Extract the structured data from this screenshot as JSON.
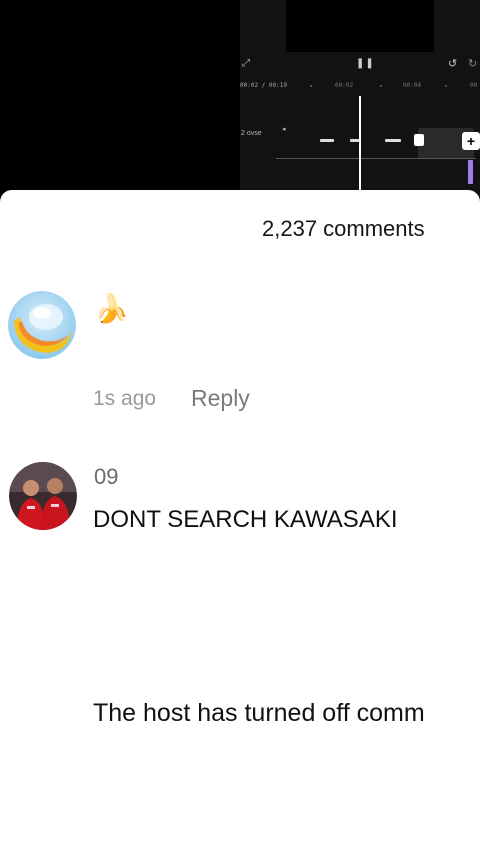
{
  "editor": {
    "timecode": "00:02 / 00:19",
    "ruler_marks": [
      "00:02",
      "00:04",
      "00"
    ],
    "track_label": "2 ovse",
    "icons": {
      "expand": "expand-icon",
      "pause": "pause-icon",
      "undo": "undo-icon",
      "redo": "redo-icon",
      "add": "plus-icon"
    },
    "accent_color": "#9b7fe6"
  },
  "comments": {
    "count_label": "2,237 comments",
    "items": [
      {
        "avatar": "banana-moon-avatar",
        "username": "",
        "text": "🍌",
        "timestamp": "1s ago",
        "reply_label": "Reply"
      },
      {
        "avatar": "soccer-players-avatar",
        "username": "09",
        "text": "DONT SEARCH KAWASAKI"
      }
    ],
    "host_notice": "The host has turned off comm"
  }
}
